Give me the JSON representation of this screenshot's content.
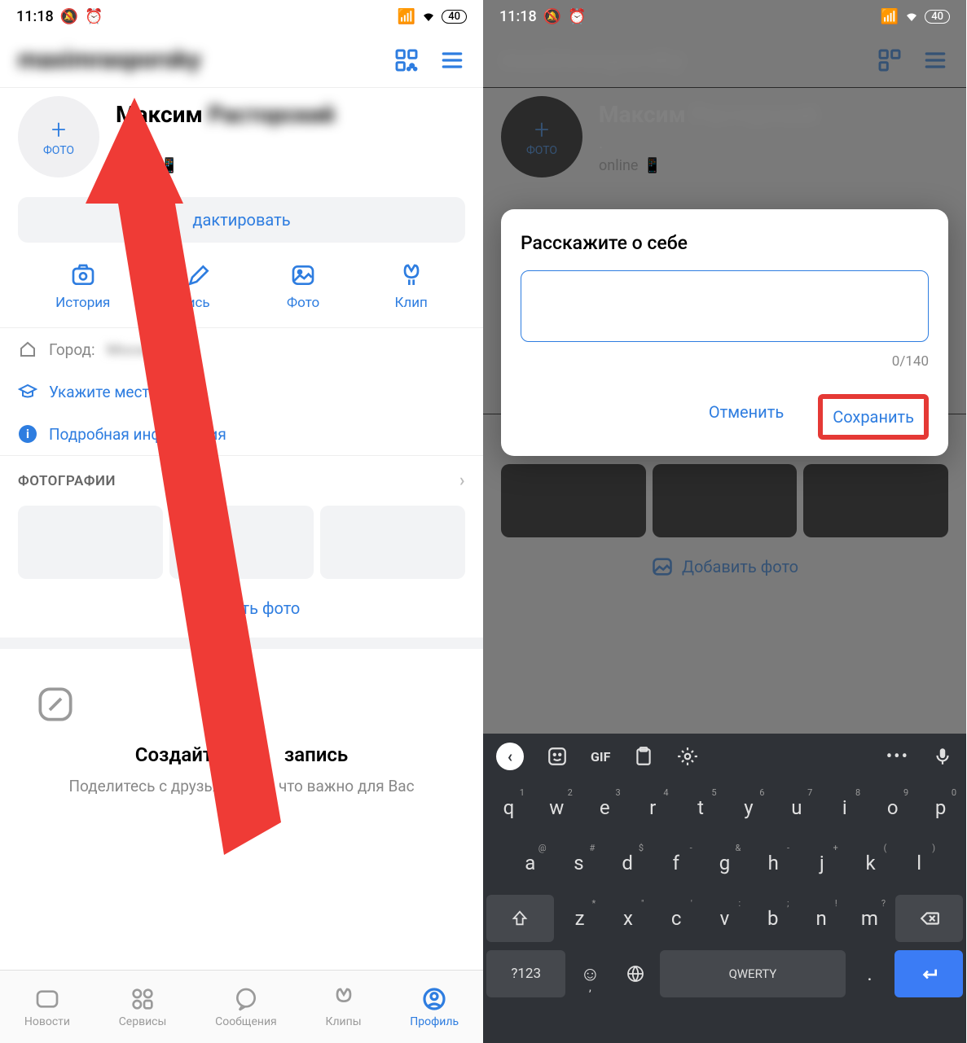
{
  "status": {
    "time": "11:18",
    "battery": "40"
  },
  "header": {
    "username": "maximrasporsky"
  },
  "profile": {
    "avatar_plus": "+",
    "avatar_label": "ФОТО",
    "first_name": "Максим",
    "last_name": "Расторский",
    "dot": ".",
    "online": "online"
  },
  "edit_label": "Редактировать",
  "edit_label_partial": "дактировать",
  "quick": {
    "story": "История",
    "post": "Запись",
    "post_partial": "ись",
    "photo": "Фото",
    "clip": "Клип"
  },
  "info": {
    "city_label": "Город:",
    "city_value": "Москва",
    "edu": "Укажите место учёбы",
    "more": "Подробная информация"
  },
  "photos_header": "ФОТОГРАФИИ",
  "add_photo": "Добавить фото",
  "add_photo_partial": "авить фото",
  "empty": {
    "title": "Создайте первую запись",
    "title_left": "Создайте пер",
    "title_right": "запись",
    "sub": "Поделитесь с друзьями тем, что важно для Вас"
  },
  "nav": {
    "news": "Новости",
    "services": "Сервисы",
    "messages": "Сообщения",
    "clips": "Клипы",
    "profile": "Профиль"
  },
  "dialog": {
    "title": "Расскажите о себе",
    "counter": "0/140",
    "cancel": "Отменить",
    "save": "Сохранить"
  },
  "right_profile_name": "Максим",
  "keyboard": {
    "row1": [
      "q",
      "w",
      "e",
      "r",
      "t",
      "y",
      "u",
      "i",
      "o",
      "p"
    ],
    "sup1": [
      "1",
      "2",
      "3",
      "4",
      "5",
      "6",
      "7",
      "8",
      "9",
      "0"
    ],
    "row2": [
      "a",
      "s",
      "d",
      "f",
      "g",
      "h",
      "j",
      "k",
      "l"
    ],
    "sup2": [
      "@",
      "#",
      "$",
      "-",
      "&",
      "-",
      "+",
      "(",
      ")"
    ],
    "row3": [
      "z",
      "x",
      "c",
      "v",
      "b",
      "n",
      "m"
    ],
    "sup3": [
      "*",
      "\"",
      "'",
      ":",
      ";",
      "!",
      "?"
    ],
    "numkey": "?123",
    "space": "QWERTY"
  }
}
